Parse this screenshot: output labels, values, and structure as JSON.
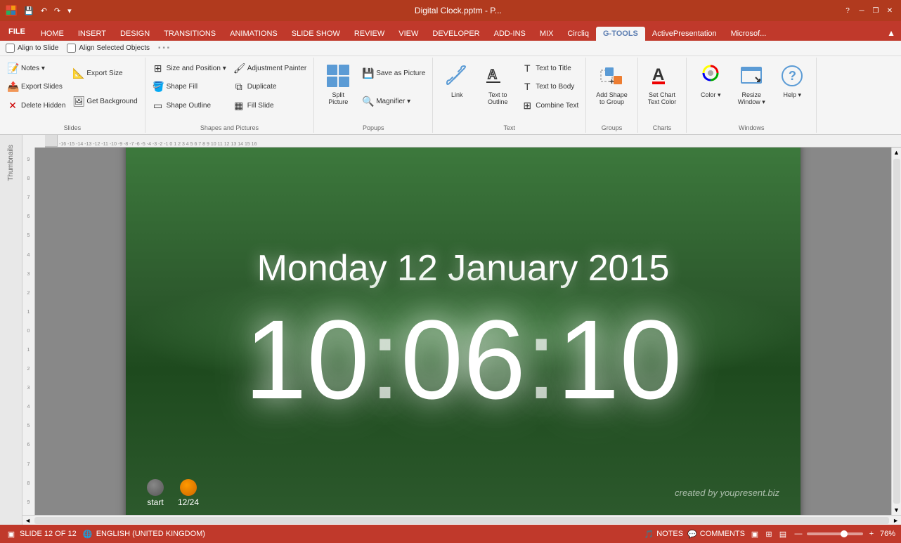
{
  "titlebar": {
    "app_icon": "P",
    "title": "Digital Clock.pptm - P...",
    "quick_access": [
      "save",
      "undo",
      "redo",
      "customize"
    ],
    "window_controls": [
      "minimize",
      "restore",
      "close"
    ],
    "help_icon": "?"
  },
  "ribbon": {
    "tabs": [
      "FILE",
      "HOME",
      "INSERT",
      "DESIGN",
      "TRANSITIONS",
      "ANIMATIONS",
      "SLIDE SHOW",
      "REVIEW",
      "VIEW",
      "DEVELOPER",
      "ADD-INS",
      "MIX",
      "Circliq",
      "G-TOOLS",
      "ActivePresentation",
      "Microsof..."
    ],
    "active_tab": "G-TOOLS",
    "groups": {
      "slides": {
        "label": "Slides",
        "items": [
          "Notes ▾",
          "Export Slides",
          "Delete Hidden",
          "Export Size",
          "Get Background"
        ]
      },
      "shapes_pictures": {
        "label": "Shapes and Pictures",
        "items": [
          "Size and Position ▾",
          "Shape Fill",
          "Shape Outline",
          "Adjustment Painter",
          "Duplicate",
          "Fill Slide"
        ]
      },
      "popups": {
        "label": "Popups",
        "items": [
          "Split Picture",
          "Save as Picture",
          "Magnifier ▾"
        ]
      },
      "text": {
        "label": "Text",
        "items": [
          "Link",
          "Text to Outline",
          "Text to Title",
          "Text to Body",
          "Combine Text"
        ]
      },
      "groups": {
        "label": "Groups",
        "items": [
          "Add Shape to Group"
        ]
      },
      "charts": {
        "label": "Charts",
        "items": [
          "Set Chart Text Color"
        ]
      },
      "windows": {
        "label": "Windows",
        "items": [
          "Resize Window ▾",
          "Color ▾",
          "Help ▾"
        ]
      }
    }
  },
  "toolbar": {
    "align_to_slide": "Align to Slide",
    "align_selected_objects": "Align Selected Objects"
  },
  "slide": {
    "date": "Monday 12 January 2015",
    "time": "10:06:10",
    "credit": "created by youpresent.biz",
    "controls": [
      {
        "label": "start",
        "color": "gray"
      },
      {
        "label": "12/24",
        "color": "orange"
      }
    ]
  },
  "status_bar": {
    "slide_info": "SLIDE 12 OF 12",
    "language": "ENGLISH (UNITED KINGDOM)",
    "notes_label": "NOTES",
    "comments_label": "COMMENTS",
    "zoom": "76%"
  },
  "ruler": {
    "horizontal": [
      "-16",
      "-15",
      "-14",
      "-13",
      "-12",
      "-11",
      "-10",
      "-9",
      "-8",
      "-7",
      "-6",
      "-5",
      "-4",
      "-3",
      "-2",
      "-1",
      "0",
      "1",
      "2",
      "3",
      "4",
      "5",
      "6",
      "7",
      "8",
      "9",
      "10",
      "11",
      "12",
      "13",
      "14",
      "15",
      "16"
    ],
    "vertical": [
      "-9",
      "-8",
      "-7",
      "-6",
      "-5",
      "-4",
      "-3",
      "-2",
      "-1",
      "0",
      "1",
      "2",
      "3",
      "4",
      "5",
      "6",
      "7",
      "8",
      "9"
    ]
  }
}
